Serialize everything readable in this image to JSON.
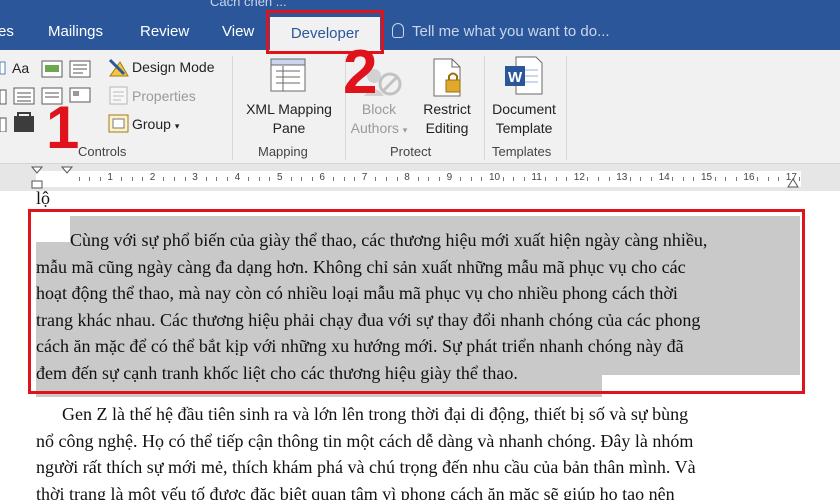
{
  "window": {
    "title_fragment": "Cách chèn ..."
  },
  "tabs": [
    {
      "label": "es"
    },
    {
      "label": "Mailings"
    },
    {
      "label": "Review"
    },
    {
      "label": "View"
    },
    {
      "label": "Developer",
      "active": true
    }
  ],
  "tell_me": {
    "text": "Tell me what you want to do..."
  },
  "ribbon": {
    "controls": {
      "label": "Controls",
      "aa_label": "Aa",
      "design_mode": "Design Mode",
      "properties": "Properties",
      "group": "Group"
    },
    "mapping": {
      "label": "Mapping",
      "xml_line1": "XML Mapping",
      "xml_line2": "Pane"
    },
    "protect": {
      "label": "Protect",
      "block_line1": "Block",
      "block_line2": "Authors",
      "restrict_line1": "Restrict",
      "restrict_line2": "Editing"
    },
    "templates": {
      "label": "Templates",
      "doc_line1": "Document",
      "doc_line2": "Template"
    }
  },
  "annotations": {
    "step1": "1",
    "step2": "2"
  },
  "ruler": {
    "numbers": [
      "1",
      "2",
      "3",
      "4",
      "5",
      "6",
      "7",
      "8",
      "9",
      "10",
      "11",
      "12",
      "13",
      "14",
      "15",
      "16",
      "17"
    ]
  },
  "document": {
    "prev_line": "lộ",
    "selected_lines": [
      "Cùng với sự phổ biến của giày thể thao, các thương hiệu mới xuất hiện ngày càng nhiều,",
      "mẫu mã cũng ngày càng đa dạng hơn. Không chỉ sản xuất những mẫu mã phục vụ cho các",
      "hoạt động thể thao, mà nay còn có nhiều loại mẫu mã phục vụ cho nhiều phong cách thời",
      "trang khác nhau. Các thương hiệu phải chạy đua với sự thay đổi nhanh chóng của các phong",
      "cách ăn mặc để có thể bắt kịp với những xu hướng mới. Sự phát triển  nhanh chóng này đã",
      "đem đến sự cạnh tranh khốc liệt cho các thương hiệu giày thể thao."
    ],
    "next_lines": [
      "Gen Z là thế hệ đầu tiên sinh ra và lớn lên trong thời đại di động, thiết bị số và sự bùng",
      "nổ công nghệ. Họ có thể tiếp cận thông tin một cách dễ dàng và nhanh chóng. Đây là nhóm",
      "người rất thích sự mới mẻ, thích khám phá và chú trọng đến nhu cầu của bản thân mình. Và",
      "thời trang là một yếu tố được đặc biệt quan tâm vì phong cách ăn mặc sẽ giúp  họ tạo nên"
    ]
  }
}
